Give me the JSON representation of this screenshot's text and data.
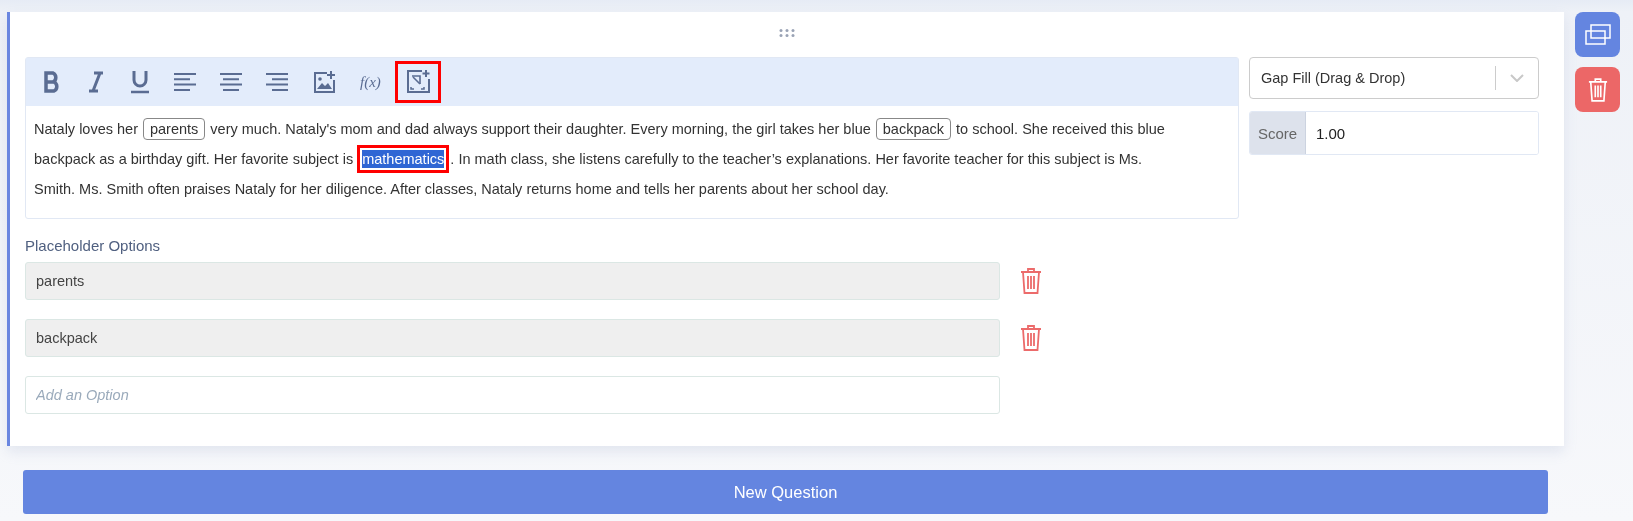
{
  "toolbar": [
    {
      "kind": "bold",
      "highlighted": false
    },
    {
      "kind": "italic",
      "highlighted": false
    },
    {
      "kind": "underline",
      "highlighted": false
    },
    {
      "kind": "align-left",
      "highlighted": false
    },
    {
      "kind": "align-center",
      "highlighted": false
    },
    {
      "kind": "align-right",
      "highlighted": false
    },
    {
      "kind": "image",
      "highlighted": false
    },
    {
      "kind": "formula",
      "label": "f(x)",
      "highlighted": false
    },
    {
      "kind": "gap",
      "highlighted": true
    }
  ],
  "lines": [
    [
      {
        "kind": "text",
        "text": "Nataly loves her"
      },
      {
        "kind": "gap",
        "text": "parents"
      },
      {
        "kind": "text",
        "text": "very much. Nataly's mom and dad always support their daughter. Every morning, the girl takes her blue"
      },
      {
        "kind": "gap",
        "text": "backpack"
      },
      {
        "kind": "text",
        "text": "to school. She received this blue"
      }
    ],
    [
      {
        "kind": "text",
        "text": "backpack as a birthday gift. Her favorite subject is"
      },
      {
        "kind": "selection",
        "text": "mathematics",
        "highlighted": true
      },
      {
        "kind": "text",
        "text": ". In math class, she listens carefully to the teacher’s explanations. Her favorite teacher for this subject is Ms."
      }
    ],
    [
      {
        "kind": "text",
        "text": "Smith. Ms. Smith often praises Nataly for her diligence. After classes, Nataly returns home and tells her parents about her school day."
      }
    ]
  ],
  "question_type": {
    "value": "Gap Fill (Drag & Drop)"
  },
  "score": {
    "label": "Score",
    "value": "1.00"
  },
  "placeholder_options": {
    "title": "Placeholder Options",
    "options": [
      "parents",
      "backpack"
    ],
    "new_option": {
      "placeholder": "Add an Option"
    }
  },
  "new_question_button": "New Question"
}
